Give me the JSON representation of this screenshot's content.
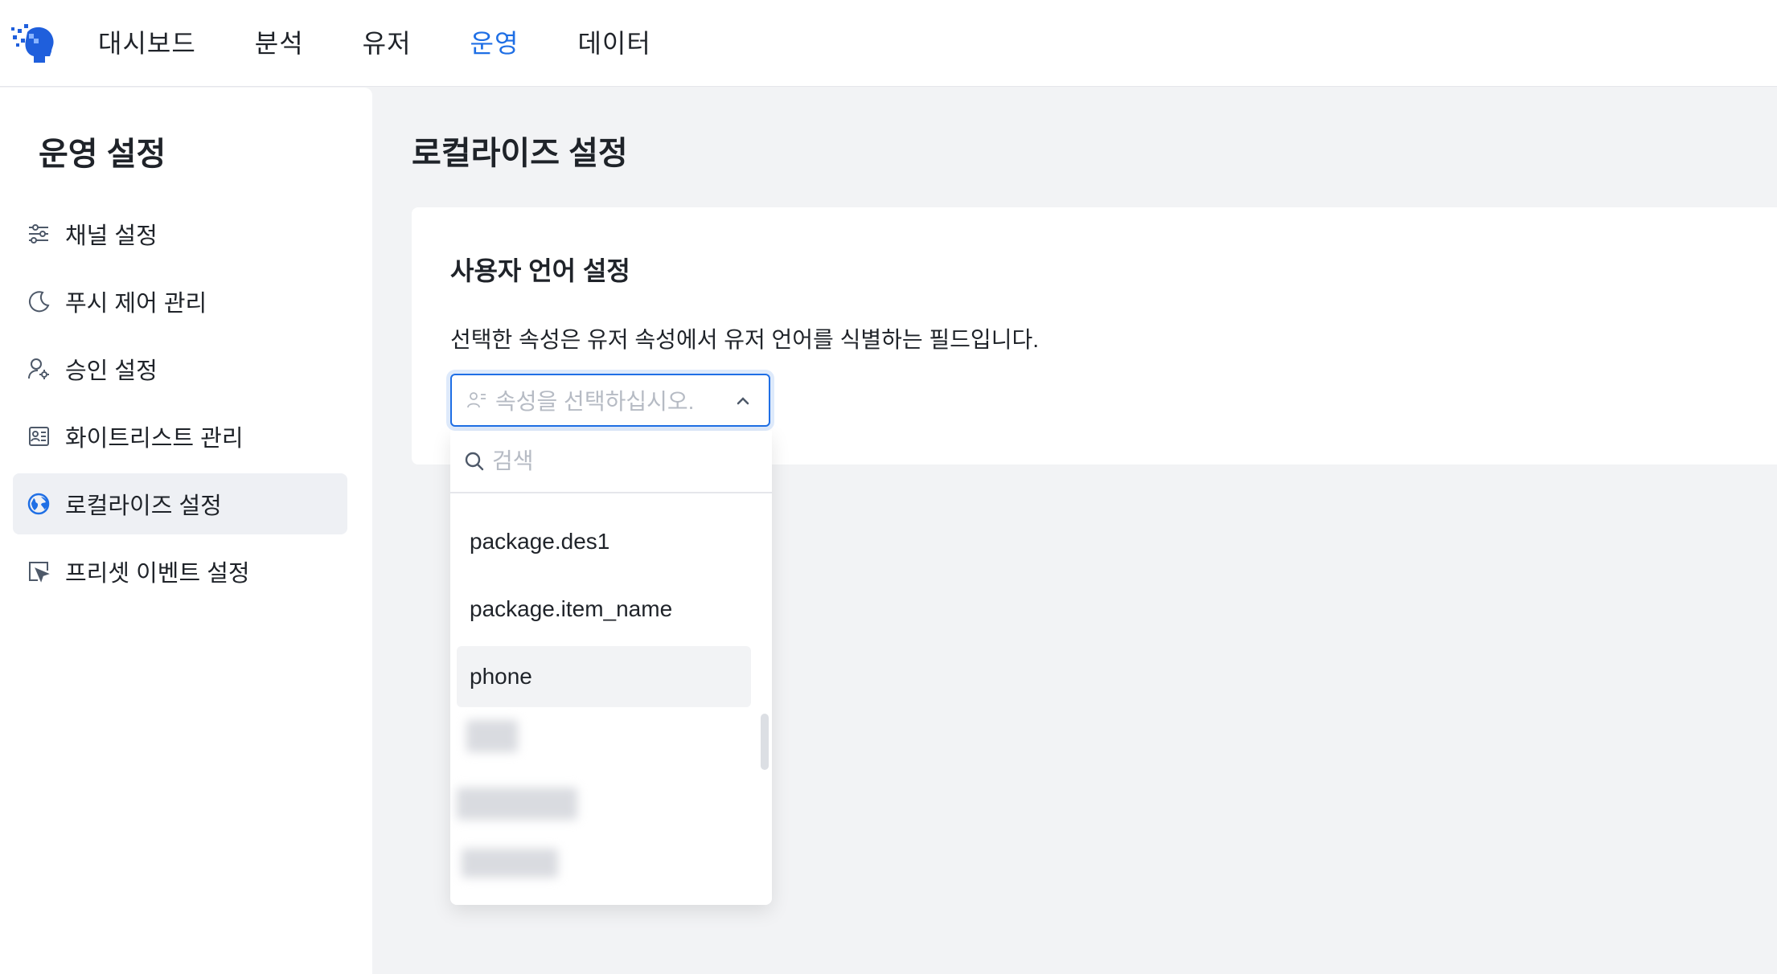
{
  "nav": {
    "items": [
      {
        "label": "대시보드",
        "active": false
      },
      {
        "label": "분석",
        "active": false
      },
      {
        "label": "유저",
        "active": false
      },
      {
        "label": "운영",
        "active": true
      },
      {
        "label": "데이터",
        "active": false
      }
    ]
  },
  "sidebar": {
    "title": "운영 설정",
    "items": [
      {
        "label": "채널 설정",
        "icon": "sliders-icon",
        "active": false
      },
      {
        "label": "푸시 제어 관리",
        "icon": "moon-icon",
        "active": false
      },
      {
        "label": "승인 설정",
        "icon": "user-gear-icon",
        "active": false
      },
      {
        "label": "화이트리스트 관리",
        "icon": "id-card-icon",
        "active": false
      },
      {
        "label": "로컬라이즈 설정",
        "icon": "globe-icon",
        "active": true
      },
      {
        "label": "프리셋 이벤트 설정",
        "icon": "cursor-click-icon",
        "active": false
      }
    ]
  },
  "main": {
    "title": "로컬라이즈 설정",
    "card": {
      "title": "사용자 언어 설정",
      "description": "선택한 속성은 유저 속성에서 유저 언어를 식별하는 필드입니다.",
      "select": {
        "placeholder": "속성을 선택하십시오.",
        "icon": "user-attribute-icon"
      }
    }
  },
  "dropdown": {
    "search_placeholder": "검색",
    "options": [
      {
        "label": "package.des1",
        "hover": false
      },
      {
        "label": "package.item_name",
        "hover": false
      },
      {
        "label": "phone",
        "hover": true
      }
    ]
  },
  "colors": {
    "accent": "#1f6fe5",
    "text": "#1f2329",
    "placeholder": "#b6bbc4",
    "background": "#f2f3f5"
  }
}
